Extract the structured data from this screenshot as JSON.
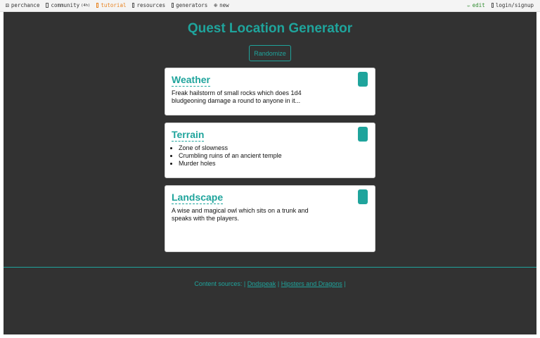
{
  "topnav": {
    "brand": "perchance",
    "community": "community",
    "community_tag": "(4h)",
    "tutorial": "tutorial",
    "resources": "resources",
    "generators": "generators",
    "new": "new",
    "edit": "edit",
    "login": "login/signup",
    "active_color": "#e8821e",
    "edit_color": "#2e8b2e"
  },
  "app": {
    "title": "Quest Location Generator",
    "randomize_label": "Randomize",
    "accent_color": "#1fa49c",
    "background_color": "#323232"
  },
  "cards": [
    {
      "title": "Weather",
      "text": "Freak hailstorm of small rocks which does 1d4 bludgeoning damage a round to anyone in it..."
    },
    {
      "title": "Terrain",
      "items": [
        "Zone of slowness",
        "Crumbling ruins of an ancient temple",
        "Murder holes"
      ]
    },
    {
      "title": "Landscape",
      "text": "A wise and magical owl which sits on a trunk and speaks with the players."
    }
  ],
  "footer": {
    "prefix": "Content sources: |",
    "link1": "Dndspeak",
    "sep1": "|",
    "link2": "Hipsters and Dragons",
    "sep2": "|"
  }
}
